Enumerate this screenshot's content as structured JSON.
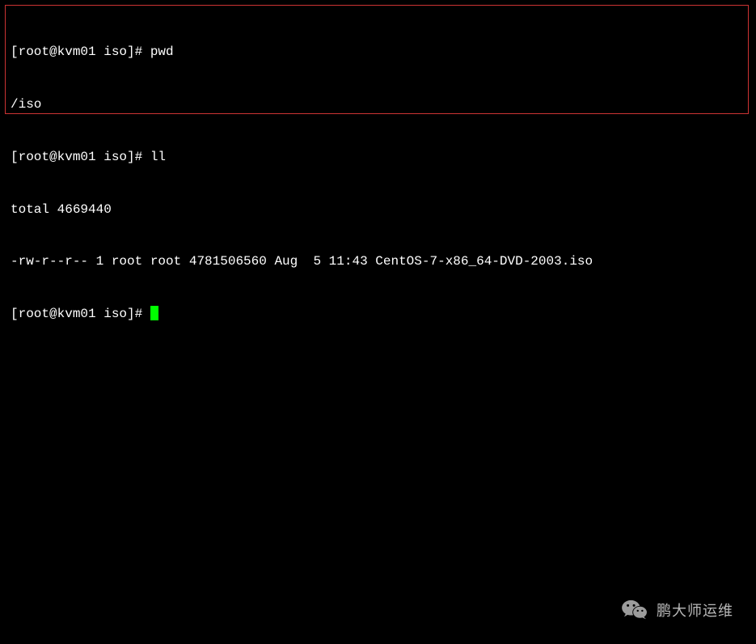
{
  "terminal": {
    "lines": [
      {
        "prompt": "[root@kvm01 iso]# ",
        "command": "pwd"
      },
      {
        "output": "/iso"
      },
      {
        "prompt": "[root@kvm01 iso]# ",
        "command": "ll"
      },
      {
        "output": "total 4669440"
      },
      {
        "output": "-rw-r--r-- 1 root root 4781506560 Aug  5 11:43 CentOS-7-x86_64-DVD-2003.iso"
      },
      {
        "prompt": "[root@kvm01 iso]# ",
        "cursor": true
      }
    ],
    "border_color": "#cc3333",
    "cursor_color": "#00ff00"
  },
  "watermark": {
    "text": "鹏大师运维",
    "icon": "wechat-icon"
  }
}
